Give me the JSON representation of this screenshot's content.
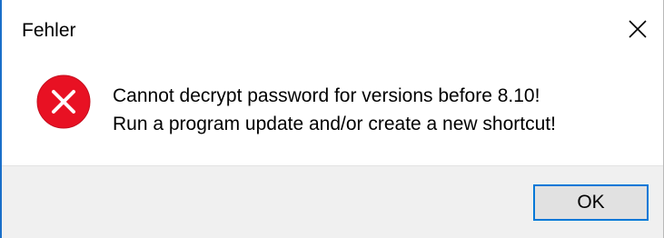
{
  "window": {
    "title": "Fehler",
    "close_icon": "close-icon"
  },
  "content": {
    "icon": "error-icon",
    "message_lines": [
      "Cannot decrypt password for versions before 8.10!",
      "Run a program update and/or create a new shortcut!"
    ]
  },
  "footer": {
    "ok_label": "OK"
  },
  "colors": {
    "accent": "#0078d7",
    "error_red": "#e81123",
    "footer_bg": "#f0f0f0",
    "button_bg": "#e1e1e1"
  }
}
